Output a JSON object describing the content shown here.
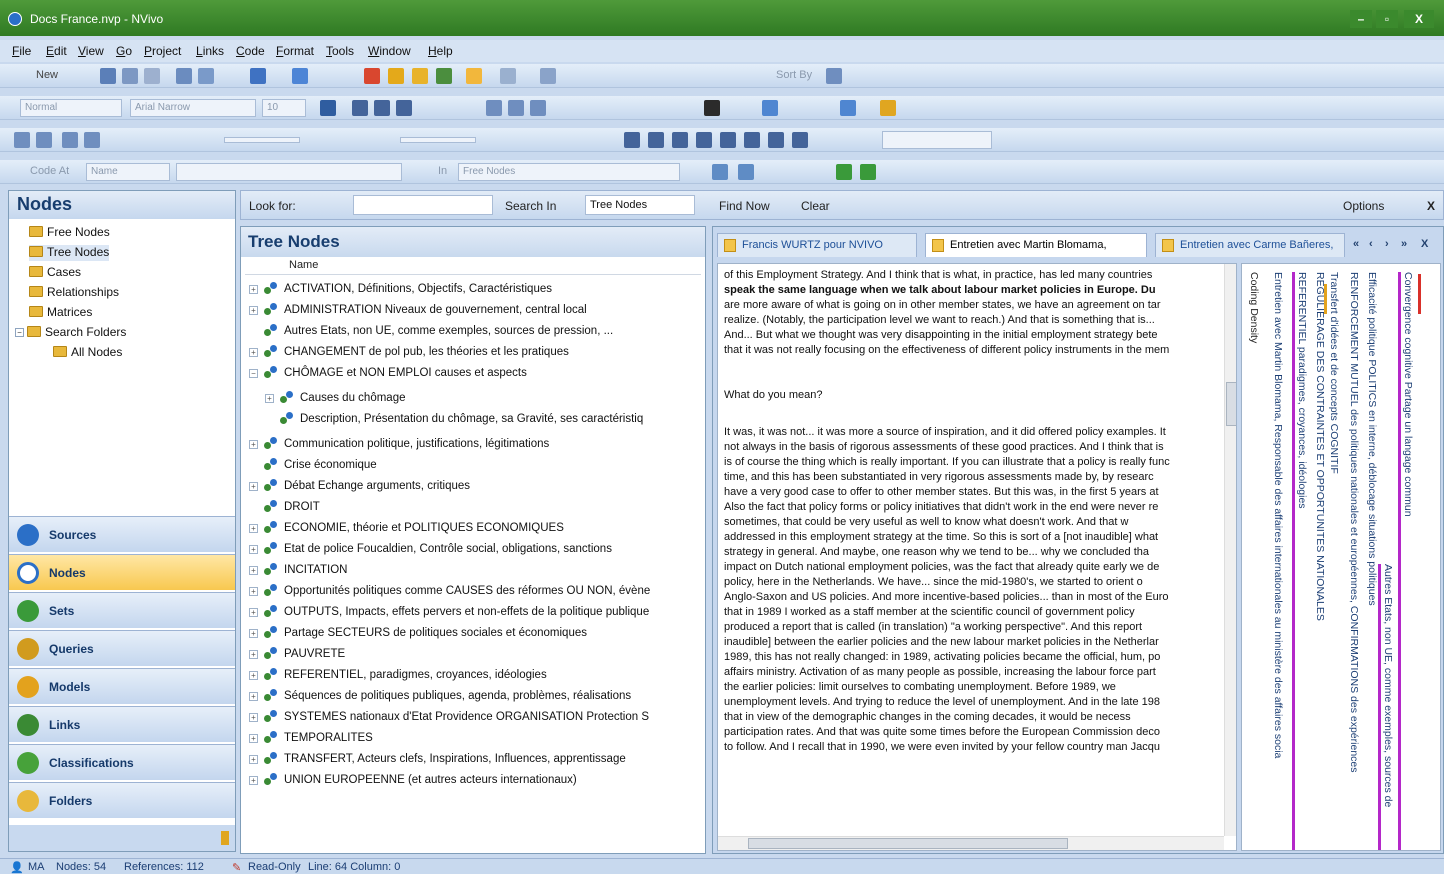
{
  "window": {
    "title": "Docs France.nvp - NVivo",
    "controls": {
      "minimize": "–",
      "maximize": "▫",
      "close": "X"
    }
  },
  "menu": [
    "File",
    "Edit",
    "View",
    "Go",
    "Project",
    "Links",
    "Code",
    "Format",
    "Tools",
    "Window",
    "Help"
  ],
  "toolbar": {
    "new_label": "New",
    "sort_by": "Sort By",
    "style_field": "Normal",
    "font_field": "Arial Narrow",
    "size_field": "10",
    "code_at_label": "Code At",
    "code_at_field": "Name",
    "in_label": "In",
    "in_field": "Free Nodes"
  },
  "nav": {
    "title": "Nodes",
    "tree": [
      "Free Nodes",
      "Tree Nodes",
      "Cases",
      "Relationships",
      "Matrices",
      "Search Folders",
      "All Nodes"
    ],
    "buttons": [
      {
        "label": "Sources",
        "color": "#2b6fc7"
      },
      {
        "label": "Nodes",
        "color": "#2b6fc7"
      },
      {
        "label": "Sets",
        "color": "#3a9a3a"
      },
      {
        "label": "Queries",
        "color": "#d19b1e"
      },
      {
        "label": "Models",
        "color": "#e3a21d"
      },
      {
        "label": "Links",
        "color": "#3a8a34"
      },
      {
        "label": "Classifications",
        "color": "#47a23a"
      },
      {
        "label": "Folders",
        "color": "#e8b83b"
      }
    ]
  },
  "findbar": {
    "look_for_label": "Look for:",
    "search_in_label": "Search In",
    "search_in_value": "Tree Nodes",
    "find_now": "Find Now",
    "clear": "Clear",
    "options": "Options",
    "close": "X"
  },
  "tree_panel": {
    "title": "Tree Nodes",
    "column": "Name",
    "nodes": [
      {
        "label": "ACTIVATION, Définitions, Objectifs, Caractéristiques",
        "expander": "+",
        "indent": 0
      },
      {
        "label": "ADMINISTRATION Niveaux de gouvernement, central local",
        "expander": "+",
        "indent": 0
      },
      {
        "label": "Autres Etats, non UE, comme exemples, sources de pression, ...",
        "expander": "",
        "indent": 0
      },
      {
        "label": "CHANGEMENT de pol pub, les théories et les pratiques",
        "expander": "+",
        "indent": 0
      },
      {
        "label": "CHÔMAGE et NON EMPLOI causes et aspects",
        "expander": "−",
        "indent": 0
      },
      {
        "label": "Causes du chômage",
        "expander": "+",
        "indent": 1
      },
      {
        "label": "Description, Présentation du chômage, sa Gravité, ses caractéristiq",
        "expander": "",
        "indent": 1
      },
      {
        "label": "Communication politique, justifications, légitimations",
        "expander": "+",
        "indent": 0
      },
      {
        "label": "Crise économique",
        "expander": "",
        "indent": 0
      },
      {
        "label": "Débat Echange arguments, critiques",
        "expander": "+",
        "indent": 0
      },
      {
        "label": "DROIT",
        "expander": "",
        "indent": 0
      },
      {
        "label": "ECONOMIE, théorie et POLITIQUES ECONOMIQUES",
        "expander": "+",
        "indent": 0
      },
      {
        "label": "Etat de police Foucaldien, Contrôle social, obligations, sanctions",
        "expander": "+",
        "indent": 0
      },
      {
        "label": "INCITATION",
        "expander": "+",
        "indent": 0
      },
      {
        "label": "Opportunités politiques comme CAUSES des réformes OU NON, évène",
        "expander": "+",
        "indent": 0
      },
      {
        "label": "OUTPUTS, Impacts, effets pervers et non-effets de la politique publique",
        "expander": "+",
        "indent": 0
      },
      {
        "label": "Partage SECTEURS de politiques sociales et économiques",
        "expander": "+",
        "indent": 0
      },
      {
        "label": "PAUVRETE",
        "expander": "+",
        "indent": 0
      },
      {
        "label": "REFERENTIEL, paradigmes, croyances, idéologies",
        "expander": "+",
        "indent": 0
      },
      {
        "label": "Séquences de politiques publiques, agenda, problèmes, réalisations",
        "expander": "+",
        "indent": 0
      },
      {
        "label": "SYSTEMES nationaux d'Etat Providence ORGANISATION Protection S",
        "expander": "+",
        "indent": 0
      },
      {
        "label": "TEMPORALITES",
        "expander": "+",
        "indent": 0
      },
      {
        "label": "TRANSFERT, Acteurs clefs, Inspirations, Influences, apprentissage",
        "expander": "+",
        "indent": 0
      },
      {
        "label": "UNION EUROPEENNE (et autres acteurs internationaux)",
        "expander": "+",
        "indent": 0
      }
    ]
  },
  "doc_panel": {
    "tabs": [
      "Francis WURTZ pour NVIVO",
      "Entretien avec Martin Blomama,",
      "Entretien avec Carme Bañeres,"
    ],
    "tab_nav": [
      "«",
      "‹",
      "›",
      "»",
      "X"
    ],
    "paragraphs": [
      "of this Employment Strategy. And I think that is what, in practice, has led many countries",
      "speak the same language when we talk about labour market policies in Europe. Du",
      "are more aware of what is going on in other member states, we have an agreement on tar",
      "realize. (Notably, the participation level we want to reach.) And that is something that is...",
      "And... But what we thought was very disappointing in the initial employment strategy bete",
      "that it was not really focusing on the effectiveness of different policy instruments in the mem",
      "What do you mean?",
      "It was, it was not... it was more a source of inspiration, and it did offered policy examples. It",
      "not always in the basis of rigorous assessments of these good practices. And I think that is",
      "is of course the thing which is really important. If you can illustrate that a policy is really func",
      "time, and this has been substantiated in very rigorous assessments made by, by researc",
      "have a very good case to offer to other member states. But this was, in the first 5 years at",
      "Also the fact that policy forms or policy initiatives that didn't work in the end were never re",
      "sometimes, that could be very useful as well to know what doesn't work. And that w",
      "addressed in this employment strategy at the time. So this is sort of a [not inaudible] what",
      "strategy in general. And maybe, one reason why we tend to be... why we concluded tha",
      "impact on Dutch national employment policies, was the fact that already quite early we de",
      "policy, here in the Netherlands. We have... since the mid-1980's, we started to orient o",
      "Anglo-Saxon and US policies. And more incentive-based policies... than in most of the Euro",
      "that in 1989 I worked as a staff member at the scientific council of government policy",
      "produced a report that is called (in translation) \"a working perspective\". And this report",
      "inaudible] between the earlier policies and the new labour market policies in the Netherlar",
      "1989, this has not really changed: in 1989, activating policies became the official, hum, po",
      "affairs ministry. Activation of as many people as possible, increasing the labour force part",
      "the earlier policies: limit ourselves to combating unemployment. Before 1989, we",
      "unemployment levels. And trying to reduce the level of unemployment. And in the late 198",
      "that in view of the demographic changes in the coming decades, it would be necess",
      "participation rates. And that was quite some times before the European Commission deco",
      "to follow. And I recall that in 1990, we were even invited by your fellow country man Jacqu"
    ],
    "stripes": [
      "Coding Density",
      "Entretien avec Martin Blomama, Responsable des affaires internationales au ministère des affaires socia",
      "REFERENTIEL paradigmes, croyances, idéologies",
      "REGULIERAGE DES CONTRAINTES ET OPPORTUNITES NATIONALES",
      "Transfert d'idées et de concepts COGNITIF",
      "RENFORCEMENT MUTUEL des politiques nationales et européennes, CONFIRMATIONS des expériences",
      "Efficacité politique POLITICS en interne, déblocage situations politiques",
      "Autres Etats, non UE, comme exemples, sources de",
      "Convergence cognitive Partage un langage commun"
    ]
  },
  "status": {
    "user": "MA",
    "nodes": "Nodes: 54",
    "references": "References: 112",
    "readonly": "Read-Only",
    "position": "Line: 64 Column: 0"
  }
}
